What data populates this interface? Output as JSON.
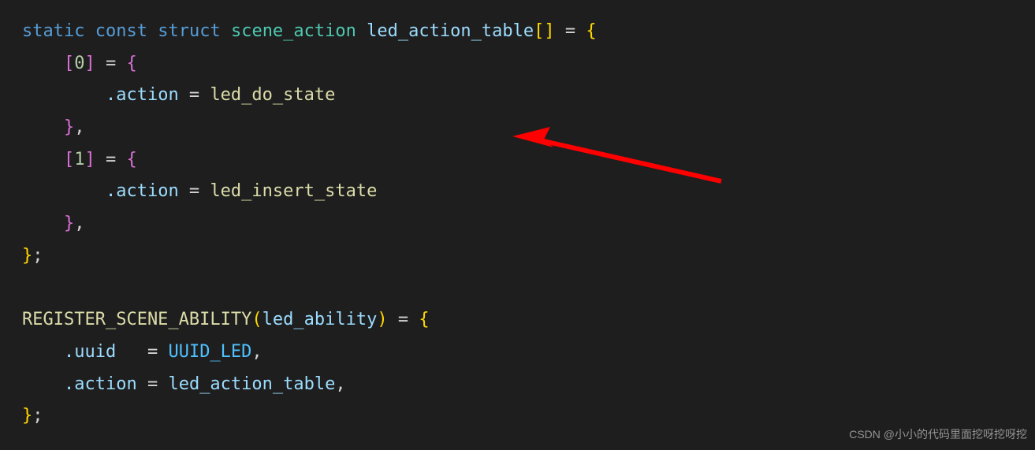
{
  "code": {
    "kw_static": "static",
    "kw_const": "const",
    "kw_struct": "struct",
    "type_scene_action": "scene_action",
    "var_led_action_table": "led_action_table",
    "brackets_empty": "[]",
    "eq": " = ",
    "brace_open": "{",
    "brace_close": "}",
    "brace_close_semi": "};",
    "brace_close_comma": "},",
    "idx0_open": "[",
    "idx0_num": "0",
    "idx0_close": "]",
    "idx1_open": "[",
    "idx1_num": "1",
    "idx1_close": "]",
    "dot_action": ".action",
    "fn_led_do_state": "led_do_state",
    "fn_led_insert_state": "led_insert_state",
    "macro_register": "REGISTER_SCENE_ABILITY",
    "paren_open": "(",
    "paren_close": ")",
    "arg_led_ability": "led_ability",
    "dot_uuid": ".uuid",
    "uuid_led": "UUID_LED",
    "comma": ",",
    "action_tbl_ref": "led_action_table"
  },
  "watermark": "CSDN @小小的代码里面挖呀挖呀挖",
  "arrow": {
    "color": "#ff0000"
  }
}
